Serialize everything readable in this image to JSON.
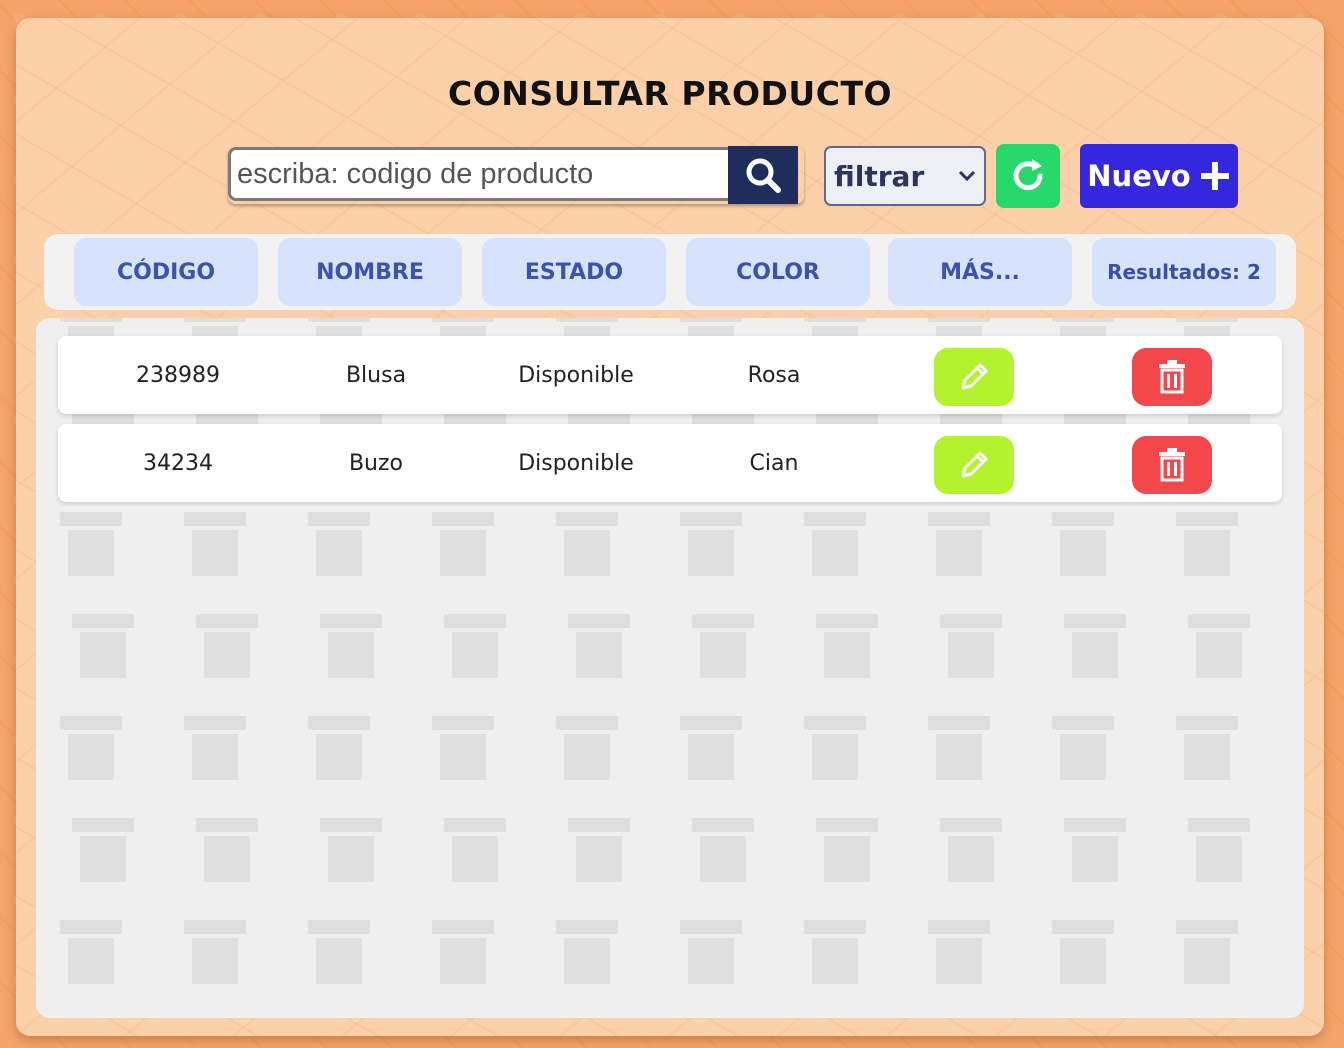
{
  "page": {
    "title": "CONSULTAR PRODUCTO"
  },
  "search": {
    "placeholder": "escriba: codigo de producto",
    "icon": "search-icon"
  },
  "filter": {
    "selected": "filtrar",
    "icon": "chevron-down-icon"
  },
  "refresh": {
    "icon": "refresh-icon"
  },
  "new_button": {
    "label": "Nuevo",
    "icon": "plus-icon"
  },
  "columns": [
    "CÓDIGO",
    "NOMBRE",
    "ESTADO",
    "COLOR",
    "MÁS..."
  ],
  "results_label": "Resultados: 2",
  "rows": [
    {
      "codigo": "238989",
      "nombre": "Blusa",
      "estado": "Disponible",
      "color": "Rosa"
    },
    {
      "codigo": "34234",
      "nombre": "Buzo",
      "estado": "Disponible",
      "color": "Cian"
    }
  ],
  "colors": {
    "edit": "#b2f22e",
    "delete": "#f4474b",
    "new": "#3427dd",
    "refresh": "#26d96a",
    "header_cell": "#d7e3fc",
    "accent_text": "#3a53b0"
  }
}
